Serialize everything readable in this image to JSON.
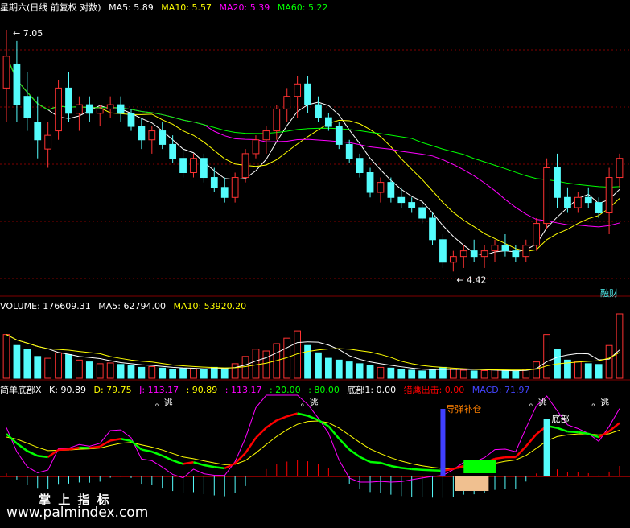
{
  "colors": {
    "bg": "#000000",
    "up": "#ff3232",
    "down": "#54fcfc",
    "white": "#ffffff",
    "ma5": "#ffffff",
    "ma10": "#ffff00",
    "ma20": "#ff00ff",
    "ma60": "#00ff00",
    "grid": "#800000",
    "k_line": "#ffffff",
    "d_line": "#ffff00",
    "j_line": "#ff00ff",
    "k_green": "#00ff00",
    "k_red": "#ff0000",
    "label_orange": "#ff8000",
    "macd": "#4040ff"
  },
  "price_panel": {
    "header": {
      "title": "星期六(日线 前复权 对数)",
      "ma5": "MA5: 5.89",
      "ma10": "MA10: 5.57",
      "ma20": "MA20: 5.39",
      "ma60": "MA60: 5.22"
    },
    "high_label": "7.05",
    "low_label": "4.42",
    "corner_label": "融财"
  },
  "volume_panel": {
    "header": {
      "vol": "VOLUME: 176609.31",
      "ma5": "MA5: 62794.00",
      "ma10": "MA10: 53920.20"
    }
  },
  "indicator_panel": {
    "header": {
      "name": "简单底部X",
      "k": "K: 90.89",
      "d": "D: 79.75",
      "j": "J: 113.17",
      "v1": ": 90.89",
      "v2": ": 113.17",
      "v3": ": 20.00",
      "v4": ": 80.00",
      "bottom": "底部1: 0.00",
      "eagle": "猎鹰出击: 0.00",
      "macd": "MACD: 71.97"
    },
    "signals": {
      "escape": "逃",
      "bottom": "底部",
      "cover": "导弹补仓"
    }
  },
  "watermark": {
    "line1": "掌 上 指 标",
    "line2": "www.palmindex.com"
  },
  "chart_data": {
    "type": "candlestick",
    "candles": [
      [
        6.3,
        7.05,
        5.9,
        6.7
      ],
      [
        6.6,
        6.9,
        5.9,
        6.1
      ],
      [
        6.2,
        6.5,
        5.8,
        5.95
      ],
      [
        5.9,
        6.2,
        5.5,
        5.7
      ],
      [
        5.6,
        5.9,
        5.4,
        5.75
      ],
      [
        5.8,
        6.4,
        5.7,
        6.3
      ],
      [
        6.3,
        6.5,
        5.9,
        6.0
      ],
      [
        6.0,
        6.2,
        5.8,
        6.1
      ],
      [
        6.1,
        6.2,
        5.9,
        6.0
      ],
      [
        6.0,
        6.1,
        5.85,
        6.05
      ],
      [
        6.05,
        6.2,
        5.95,
        6.1
      ],
      [
        6.1,
        6.2,
        5.9,
        6.0
      ],
      [
        6.0,
        6.05,
        5.8,
        5.85
      ],
      [
        5.85,
        5.95,
        5.6,
        5.7
      ],
      [
        5.7,
        5.85,
        5.55,
        5.8
      ],
      [
        5.8,
        5.9,
        5.6,
        5.65
      ],
      [
        5.65,
        5.75,
        5.45,
        5.5
      ],
      [
        5.5,
        5.6,
        5.3,
        5.35
      ],
      [
        5.35,
        5.55,
        5.3,
        5.5
      ],
      [
        5.5,
        5.55,
        5.25,
        5.3
      ],
      [
        5.3,
        5.4,
        5.15,
        5.2
      ],
      [
        5.2,
        5.3,
        5.05,
        5.1
      ],
      [
        5.1,
        5.35,
        5.05,
        5.3
      ],
      [
        5.3,
        5.6,
        5.25,
        5.55
      ],
      [
        5.55,
        5.75,
        5.5,
        5.7
      ],
      [
        5.7,
        5.85,
        5.55,
        5.8
      ],
      [
        5.8,
        6.1,
        5.7,
        6.05
      ],
      [
        6.05,
        6.3,
        5.9,
        6.2
      ],
      [
        6.2,
        6.45,
        5.95,
        6.35
      ],
      [
        6.35,
        6.45,
        6.0,
        6.1
      ],
      [
        6.1,
        6.2,
        5.9,
        5.95
      ],
      [
        5.95,
        6.0,
        5.8,
        5.85
      ],
      [
        5.85,
        5.9,
        5.6,
        5.65
      ],
      [
        5.65,
        5.7,
        5.45,
        5.5
      ],
      [
        5.5,
        5.55,
        5.3,
        5.35
      ],
      [
        5.35,
        5.4,
        5.1,
        5.15
      ],
      [
        5.15,
        5.3,
        5.05,
        5.25
      ],
      [
        5.25,
        5.3,
        5.05,
        5.1
      ],
      [
        5.1,
        5.2,
        5.0,
        5.05
      ],
      [
        5.05,
        5.1,
        4.95,
        5.0
      ],
      [
        5.0,
        5.05,
        4.85,
        4.9
      ],
      [
        4.9,
        4.95,
        4.65,
        4.7
      ],
      [
        4.7,
        4.75,
        4.45,
        4.5
      ],
      [
        4.5,
        4.6,
        4.42,
        4.55
      ],
      [
        4.55,
        4.65,
        4.45,
        4.6
      ],
      [
        4.6,
        4.7,
        4.5,
        4.55
      ],
      [
        4.55,
        4.65,
        4.45,
        4.6
      ],
      [
        4.6,
        4.7,
        4.5,
        4.65
      ],
      [
        4.65,
        4.75,
        4.55,
        4.6
      ],
      [
        4.6,
        4.65,
        4.5,
        4.55
      ],
      [
        4.55,
        4.7,
        4.5,
        4.65
      ],
      [
        4.65,
        4.9,
        4.6,
        4.85
      ],
      [
        4.85,
        5.5,
        4.8,
        5.4
      ],
      [
        5.4,
        5.55,
        5.0,
        5.1
      ],
      [
        5.1,
        5.2,
        4.95,
        5.0
      ],
      [
        5.0,
        5.15,
        4.95,
        5.1
      ],
      [
        5.1,
        5.2,
        5.0,
        5.05
      ],
      [
        5.05,
        5.1,
        4.9,
        4.95
      ],
      [
        4.95,
        5.4,
        4.75,
        5.3
      ],
      [
        5.3,
        5.55,
        5.2,
        5.5
      ]
    ],
    "volume": [
      120000,
      90000,
      80000,
      60000,
      55000,
      70000,
      65000,
      50000,
      45000,
      40000,
      42000,
      38000,
      35000,
      30000,
      32000,
      28000,
      25000,
      27000,
      26000,
      24000,
      30000,
      28000,
      40000,
      60000,
      80000,
      75000,
      95000,
      110000,
      130000,
      90000,
      70000,
      55000,
      50000,
      45000,
      40000,
      35000,
      30000,
      28000,
      25000,
      22000,
      20000,
      24000,
      30000,
      26000,
      22000,
      20000,
      21000,
      23000,
      20000,
      19000,
      25000,
      45000,
      120000,
      80000,
      50000,
      45000,
      40000,
      38000,
      90000,
      176609
    ]
  }
}
